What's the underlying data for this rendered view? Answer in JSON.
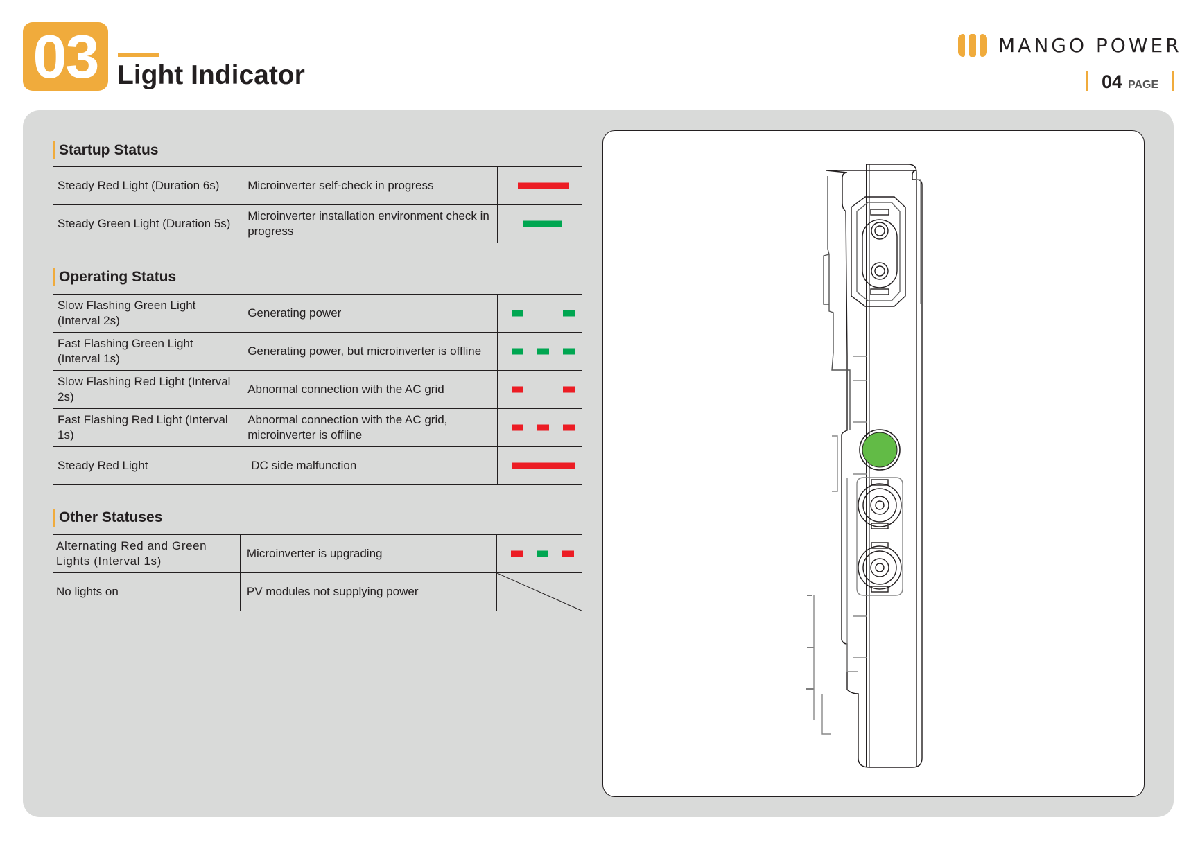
{
  "header": {
    "section_number": "03",
    "title": "Light Indicator",
    "brand": "MANGO POWER",
    "page_number": "04",
    "page_label": "PAGE"
  },
  "colors": {
    "accent": "#f0ab3c",
    "red": "#ec1c24",
    "green": "#00a651",
    "indicator_green": "#62bb46"
  },
  "sections": [
    {
      "title": "Startup Status",
      "rows": [
        {
          "light": "Steady Red Light (Duration 6s)",
          "meaning": "Microinverter self-check in progress",
          "pattern": "steady-red"
        },
        {
          "light": "Steady Green Light (Duration 5s)",
          "meaning": "Microinverter installation environment check in progress",
          "pattern": "steady-green"
        }
      ]
    },
    {
      "title": "Operating Status",
      "rows": [
        {
          "light": "Slow Flashing Green Light (Interval 2s)",
          "meaning": "Generating power",
          "pattern": "slow-green"
        },
        {
          "light": "Fast Flashing Green Light (Interval 1s)",
          "meaning": "Generating power, but microinverter is offline",
          "pattern": "fast-green"
        },
        {
          "light": "Slow Flashing Red Light (Interval 2s)",
          "meaning": "Abnormal connection with the AC grid",
          "pattern": "slow-red"
        },
        {
          "light": "Fast Flashing Red Light (Interval 1s)",
          "meaning": "Abnormal connection with the AC grid, microinverter is offline",
          "pattern": "fast-red"
        },
        {
          "light": "Steady Red Light",
          "meaning": "DC side malfunction",
          "pattern": "steady-red-long"
        }
      ]
    },
    {
      "title": "Other Statuses",
      "rows": [
        {
          "light": "Alternating Red and Green Lights (Interval 1s)",
          "meaning": "Microinverter is upgrading",
          "pattern": "alternating"
        },
        {
          "light": "No lights on",
          "meaning": "PV modules not supplying power",
          "pattern": "none"
        }
      ]
    }
  ]
}
